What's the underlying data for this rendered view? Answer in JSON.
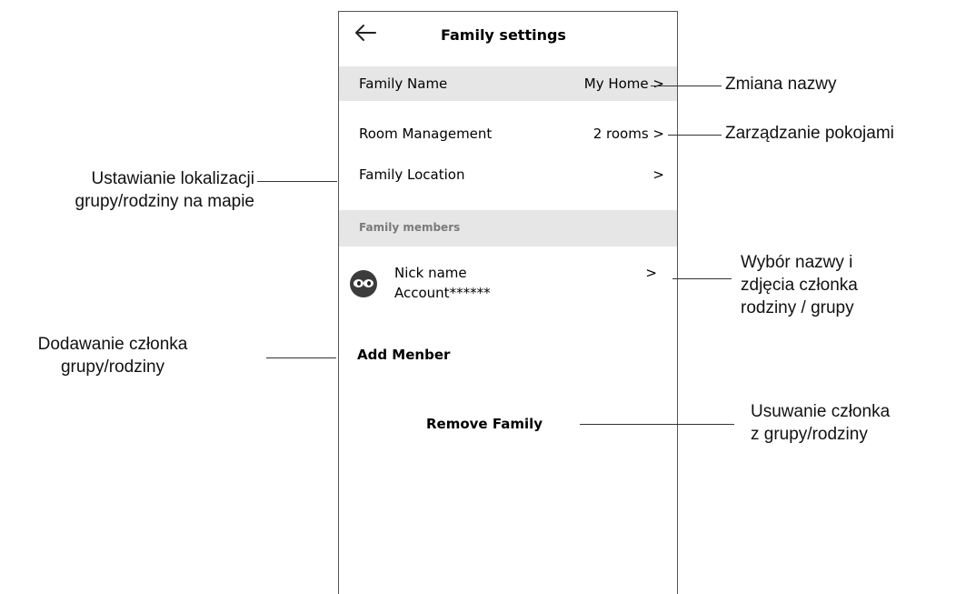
{
  "app": {
    "title": "Family settings",
    "back_icon": "back-arrow-icon"
  },
  "rows": {
    "family_name": {
      "label": "Family Name",
      "value": "My Home >"
    },
    "room_management": {
      "label": "Room Management",
      "value": "2 rooms >"
    },
    "family_location": {
      "label": "Family Location",
      "value": ">"
    }
  },
  "members_section": {
    "title": "Family members",
    "member": {
      "name": "Nick name",
      "account": "Account******",
      "arrow": ">",
      "avatar_icon": "avatar-icon"
    }
  },
  "actions": {
    "add_member": "Add Menber",
    "remove_family": "Remove Family"
  },
  "annotations": {
    "rename": "Zmiana nazwy",
    "rooms": "Zarządzanie pokojami",
    "location_1": "Ustawianie lokalizacji",
    "location_2": "grupy/rodziny na mapie",
    "member_1": "Wybór nazwy i",
    "member_2": "zdjęcia członka",
    "member_3": "rodziny / grupy",
    "add_1": "Dodawanie członka",
    "add_2": "grupy/rodziny",
    "remove_1": "Usuwanie członka",
    "remove_2": "z grupy/rodziny"
  },
  "colors": {
    "row_highlight": "#e6e6e6",
    "section_text": "#7a7a7a",
    "frame": "#555555"
  }
}
